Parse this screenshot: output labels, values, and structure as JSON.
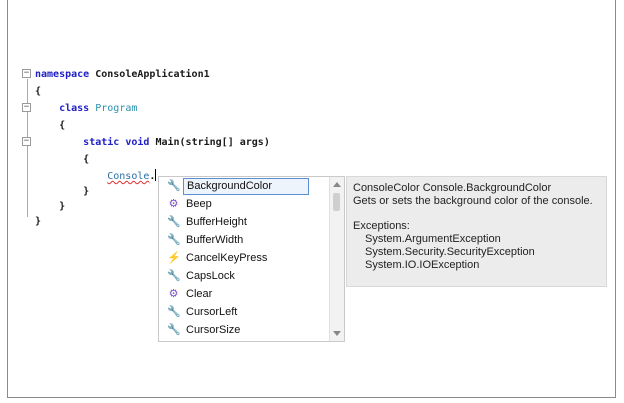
{
  "code": {
    "namespace_kw": "namespace",
    "namespace_name": "ConsoleApplication1",
    "brace_open": "{",
    "brace_close": "}",
    "class_kw": "class",
    "class_name": "Program",
    "static_kw": "static",
    "void_kw": "void",
    "method_sig": "Main(string[] args)",
    "typed_text": "Console",
    "dot": "."
  },
  "completion_list": {
    "items": [
      {
        "label": "BackgroundColor",
        "icon": "wrench-icon",
        "selected": true
      },
      {
        "label": "Beep",
        "icon": "method-icon"
      },
      {
        "label": "BufferHeight",
        "icon": "wrench-icon"
      },
      {
        "label": "BufferWidth",
        "icon": "wrench-icon"
      },
      {
        "label": "CancelKeyPress",
        "icon": "event-icon"
      },
      {
        "label": "CapsLock",
        "icon": "wrench-icon"
      },
      {
        "label": "Clear",
        "icon": "method-icon"
      },
      {
        "label": "CursorLeft",
        "icon": "wrench-icon"
      },
      {
        "label": "CursorSize",
        "icon": "wrench-icon"
      }
    ]
  },
  "tooltip": {
    "signature": "ConsoleColor Console.BackgroundColor",
    "description": "Gets or sets the background color of the console.",
    "exceptions_label": "Exceptions:",
    "exceptions": [
      "System.ArgumentException",
      "System.Security.SecurityException",
      "System.IO.IOException"
    ]
  },
  "colors": {
    "keyword": "#2020c8",
    "type": "#2b91af",
    "selection_border": "#5a8fd6",
    "tooltip_bg": "#ececec"
  }
}
